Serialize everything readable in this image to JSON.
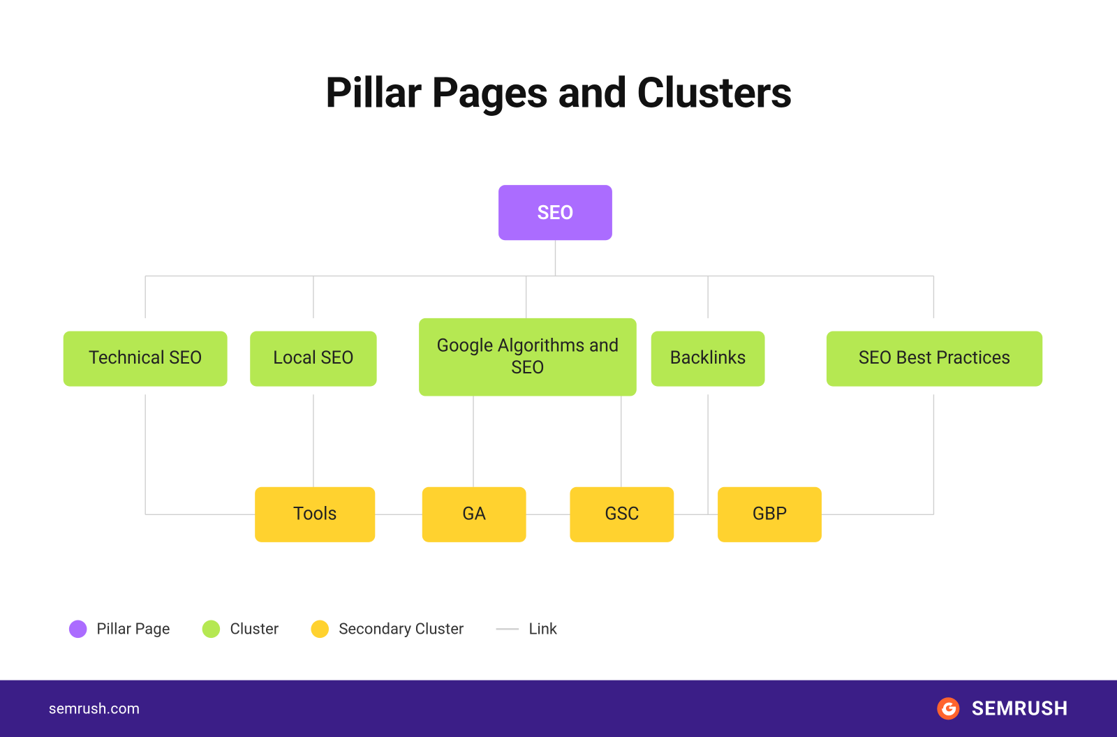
{
  "title": "Pillar Pages and Clusters",
  "pillar": {
    "label": "SEO"
  },
  "clusters": [
    {
      "key": "technical",
      "label": "Technical SEO"
    },
    {
      "key": "local",
      "label": "Local SEO"
    },
    {
      "key": "algorithms",
      "label": "Google Algorithms and SEO"
    },
    {
      "key": "backlinks",
      "label": "Backlinks"
    },
    {
      "key": "best",
      "label": "SEO Best Practices"
    }
  ],
  "secondary": [
    {
      "key": "tools",
      "label": "Tools"
    },
    {
      "key": "ga",
      "label": "GA"
    },
    {
      "key": "gsc",
      "label": "GSC"
    },
    {
      "key": "gbp",
      "label": "GBP"
    }
  ],
  "legend": {
    "pillar": "Pillar Page",
    "cluster": "Cluster",
    "secondary": "Secondary Cluster",
    "link": "Link"
  },
  "footer": {
    "url": "semrush.com",
    "brand": "SEMRUSH"
  },
  "colors": {
    "pillar": "#AB6CFF",
    "cluster": "#B5E852",
    "secondary": "#FFD22F",
    "link": "#cfcfcf",
    "footer": "#3B1E87"
  }
}
